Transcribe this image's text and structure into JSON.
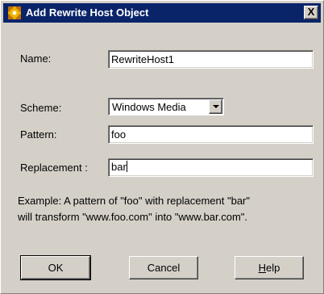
{
  "window": {
    "title": "Add Rewrite Host Object",
    "close_glyph": "X",
    "icon": "gear-icon"
  },
  "form": {
    "name_label": "Name:",
    "name_value": "RewriteHost1",
    "scheme_label": "Scheme:",
    "scheme_value": "Windows Media",
    "pattern_label": "Pattern:",
    "pattern_value": "foo",
    "replacement_label": "Replacement :",
    "replacement_value": "bar"
  },
  "example": {
    "line1": "Example:  A pattern of \"foo\" with replacement \"bar\"",
    "line2": "will transform \"www.foo.com\" into \"www.bar.com\"."
  },
  "buttons": {
    "ok": "OK",
    "cancel": "Cancel",
    "help_first": "H",
    "help_rest": "elp"
  },
  "colors": {
    "titlebar": "#0a246a",
    "dialog_bg": "#d4d0c8",
    "icon_fill": "#f0b400"
  }
}
